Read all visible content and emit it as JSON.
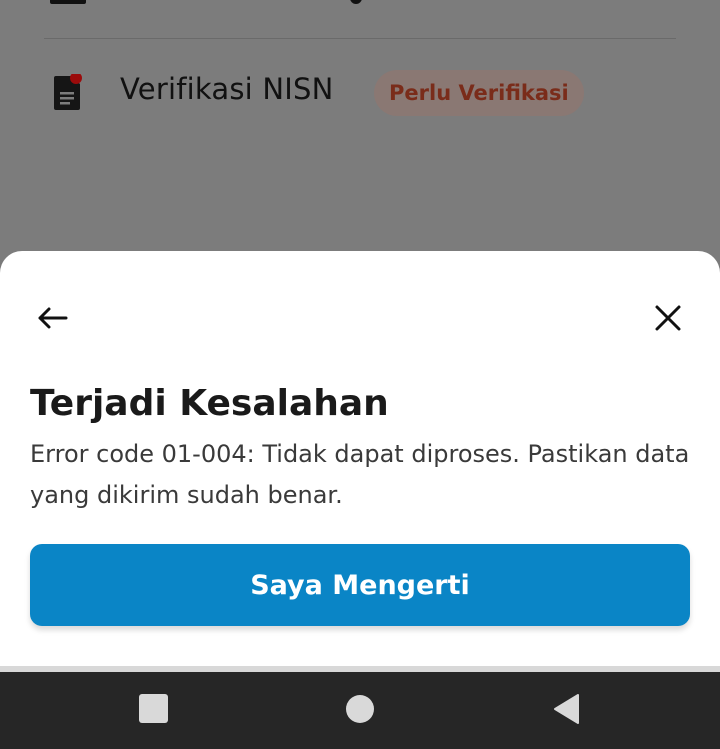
{
  "background_page": {
    "verification_item": {
      "title": "Verifikasi NISN",
      "status": "Perlu Verifikasi",
      "icon": "document-icon",
      "notification_dot_color": "#9b0b0b"
    }
  },
  "dialog": {
    "back_icon": "arrow-left-icon",
    "close_icon": "close-icon",
    "title": "Terjadi Kesalahan",
    "message": "Error code 01-004: Tidak dapat diproses. Pastikan data yang dikirim sudah benar.",
    "primary_button_label": "Saya Mengerti",
    "accent_color": "#0a85c6"
  },
  "system_nav": {
    "recents_icon": "square-icon",
    "home_icon": "circle-icon",
    "back_icon": "triangle-back-icon"
  }
}
